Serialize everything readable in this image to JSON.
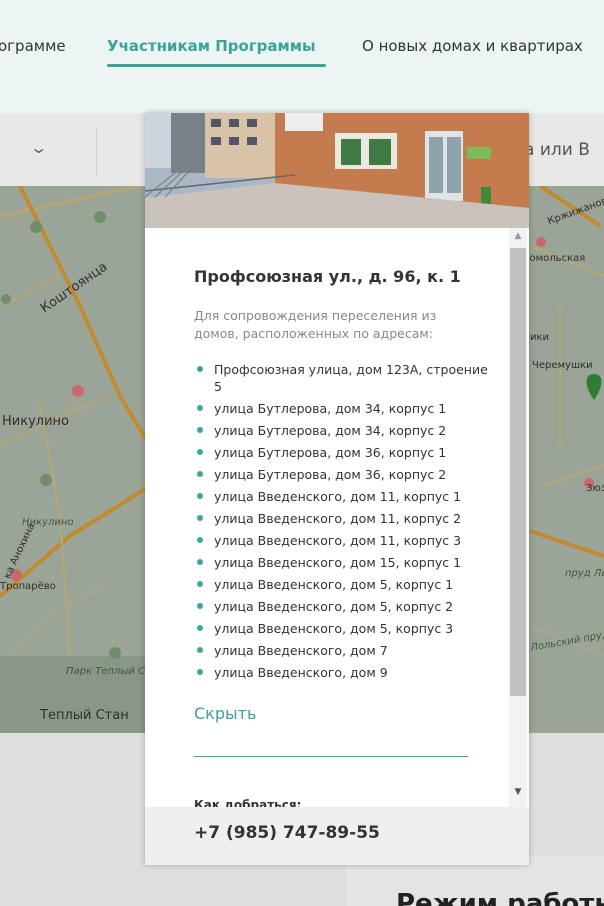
{
  "nav": {
    "items": [
      {
        "label": "ограмме",
        "active": false
      },
      {
        "label": "Участникам Программы",
        "active": true
      },
      {
        "label": "О новых домах и квартирах",
        "active": false
      }
    ]
  },
  "background": {
    "search_fragment": "а или В",
    "schedule_heading": "Режим работы",
    "map_labels": [
      "Коштоянца",
      "Никулино",
      "Никулино",
      "Тропарёво",
      "Парк Теплый Ст",
      "Теплый Стан",
      "ка Анохина",
      "Кржижановс",
      "сомольская",
      "ики",
      "Черемушки",
      "Зюз",
      "пруд Липнякс",
      "Лольский пруд"
    ]
  },
  "modal": {
    "title": "Профсоюзная ул., д. 96, к. 1",
    "description": "Для сопровождения переселения из домов, расположенных по адресам:",
    "addresses": [
      "Профсоюзная улица, дом 123А, строение 5",
      "улица Бутлерова, дом 34, корпус 1",
      "улица Бутлерова, дом 34, корпус 2",
      "улица Бутлерова, дом 36, корпус 1",
      "улица Бутлерова, дом 36, корпус 2",
      "улица Введенского, дом 11, корпус 1",
      "улица Введенского, дом 11, корпус 2",
      "улица Введенского, дом 11, корпус 3",
      "улица Введенского, дом 15, корпус 1",
      "улица Введенского, дом 5, корпус 1",
      "улица Введенского, дом 5, корпус 2",
      "улица Введенского, дом 5, корпус 3",
      "улица Введенского, дом 7",
      "улица Введенского, дом 9"
    ],
    "hide_label": "Скрыть",
    "directions_label": "Как добраться:",
    "phone": "+7 (985) 747-89-55"
  },
  "colors": {
    "accent": "#3aa39a",
    "nav_bg": "#ecf5f4"
  },
  "icons": [
    "chevron-down-icon",
    "scroll-up-icon",
    "scroll-down-icon",
    "metro-icon",
    "park-icon",
    "map-pin-icon"
  ]
}
